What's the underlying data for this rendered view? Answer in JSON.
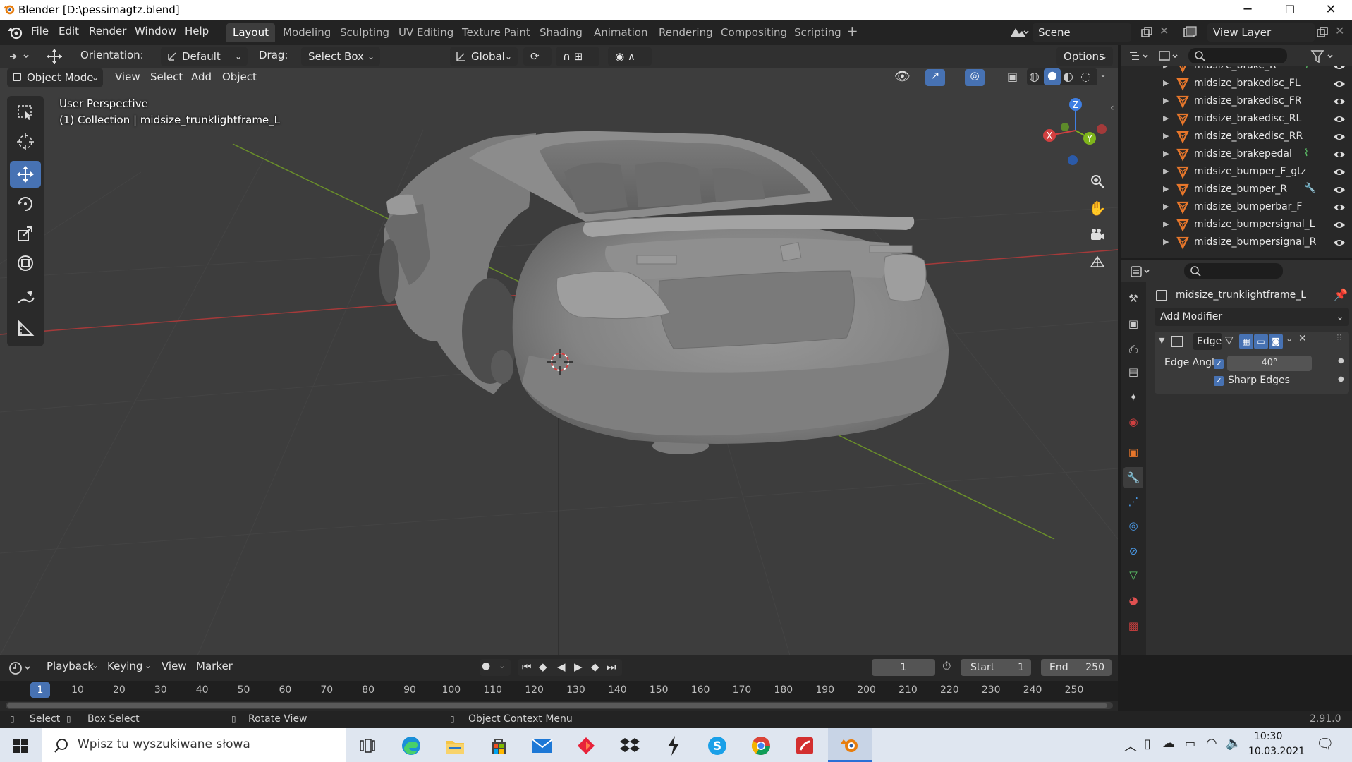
{
  "window": {
    "title": "Blender [D:\\pessimagtz.blend]",
    "minimize": "─",
    "maximize": "☐",
    "close": "✕"
  },
  "menu": [
    "File",
    "Edit",
    "Render",
    "Window",
    "Help"
  ],
  "workspaces": [
    "Layout",
    "Modeling",
    "Sculpting",
    "UV Editing",
    "Texture Paint",
    "Shading",
    "Animation",
    "Rendering",
    "Compositing",
    "Scripting"
  ],
  "active_workspace": "Layout",
  "scene": {
    "name": "Scene",
    "view_layer": "View Layer"
  },
  "tool_header": {
    "orientation_label": "Orientation:",
    "orientation_value": "Default",
    "drag_label": "Drag:",
    "drag_value": "Select Box",
    "transform_space": "Global",
    "options_label": "Options"
  },
  "viewport_header": {
    "mode": "Object Mode",
    "menus": [
      "View",
      "Select",
      "Add",
      "Object"
    ]
  },
  "viewport": {
    "perspective": "User Perspective",
    "collection_info": "(1) Collection | midsize_trunklightframe_L",
    "gizmo": {
      "x": "X",
      "y": "Y",
      "z": "Z"
    }
  },
  "outliner": {
    "rows": [
      "midsize_brake_R",
      "midsize_brakedisc_FL",
      "midsize_brakedisc_FR",
      "midsize_brakedisc_RL",
      "midsize_brakedisc_RR",
      "midsize_brakepedal",
      "midsize_bumper_F_gtz",
      "midsize_bumper_R",
      "midsize_bumperbar_F",
      "midsize_bumpersignal_L",
      "midsize_bumpersignal_R"
    ]
  },
  "properties": {
    "object_name": "midsize_trunklightframe_L",
    "add_modifier": "Add Modifier",
    "modifier": {
      "name": "Edge",
      "edge_angle_label": "Edge Angle",
      "edge_angle_value": "40°",
      "sharp_edges_label": "Sharp Edges"
    }
  },
  "timeline": {
    "menus": [
      "Playback",
      "Keying",
      "View",
      "Marker"
    ],
    "current_frame": "1",
    "start_label": "Start",
    "start_value": "1",
    "end_label": "End",
    "end_value": "250",
    "ruler": [
      "1",
      "10",
      "20",
      "30",
      "40",
      "50",
      "60",
      "70",
      "80",
      "90",
      "100",
      "110",
      "120",
      "130",
      "140",
      "150",
      "160",
      "170",
      "180",
      "190",
      "200",
      "210",
      "220",
      "230",
      "240",
      "250"
    ]
  },
  "statusbar": {
    "select": "Select",
    "box_select": "Box Select",
    "rotate_view": "Rotate View",
    "context_menu": "Object Context Menu",
    "version": "2.91.0"
  },
  "taskbar": {
    "search_placeholder": "Wpisz tu wyszukiwane słowa",
    "time": "10:30",
    "date": "10.03.2021"
  },
  "colors": {
    "accent": "#4772b3",
    "blender_orange": "#e87d0d",
    "axis_x": "#d24040",
    "axis_y": "#7fb51b",
    "axis_z": "#3f7fe3",
    "object_orange": "#e8772b"
  }
}
